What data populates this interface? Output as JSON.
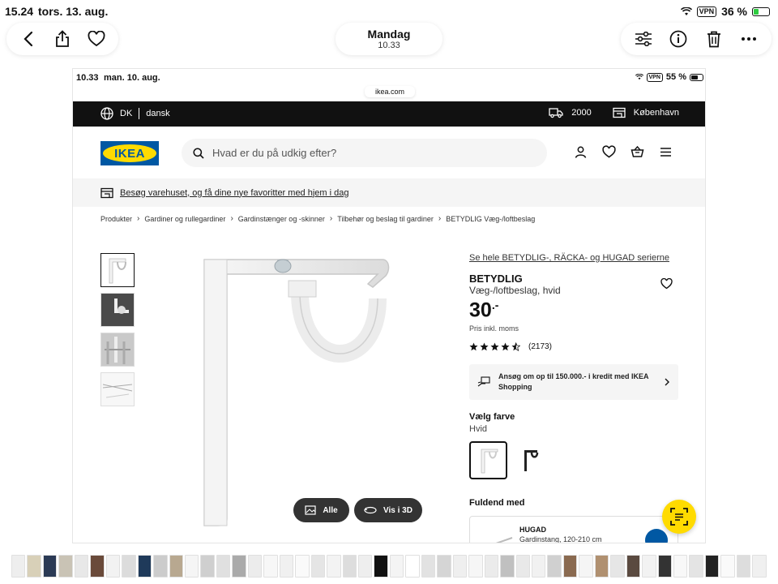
{
  "status": {
    "time": "15.24",
    "date": "tors. 13. aug.",
    "vpn": "VPN",
    "battery": "36 %",
    "battery_level": 0.36
  },
  "viewer": {
    "title": "Mandag",
    "subtitle": "10.33"
  },
  "inner_status": {
    "time": "10.33",
    "date": "man. 10. aug.",
    "vpn": "VPN",
    "battery": "55 %",
    "battery_level": 0.55
  },
  "browser": {
    "url": "ikea.com"
  },
  "topbar": {
    "country": "DK",
    "language": "dansk",
    "postcode": "2000",
    "store": "København"
  },
  "header": {
    "logo": "IKEA",
    "search_placeholder": "Hvad er du på udkig efter?"
  },
  "banner": {
    "text": "Besøg varehuset, og få dine nye favoritter med hjem i dag"
  },
  "breadcrumbs": [
    "Produkter",
    "Gardiner og rullegardiner",
    "Gardinstænger og -skinner",
    "Tilbehør og beslag til gardiner",
    "BETYDLIG Væg-/loftbeslag"
  ],
  "gallery": {
    "btn_all": "Alle",
    "btn_3d": "Vis i 3D"
  },
  "product": {
    "series_link": "Se hele BETYDLIG-, RÄCKA- og HUGAD serierne",
    "name": "BETYDLIG",
    "description": "Væg-/loftbeslag, hvid",
    "price": "30",
    "price_suffix": ".-",
    "vat_note": "Pris inkl. moms",
    "rating": 4.5,
    "rating_count": "(2173)",
    "credit_text": "Ansøg om op til 150.000.- i kredit med IKEA Shopping",
    "color_title": "Vælg farve",
    "color_value": "Hvid"
  },
  "complete": {
    "title": "Fuldend med",
    "item_name": "HUGAD",
    "item_desc": "Gardinstang, 120-210 cm"
  },
  "colors": {
    "ikea_blue": "#0058a3",
    "ikea_yellow": "#ffdb00",
    "topbar": "#111111"
  }
}
